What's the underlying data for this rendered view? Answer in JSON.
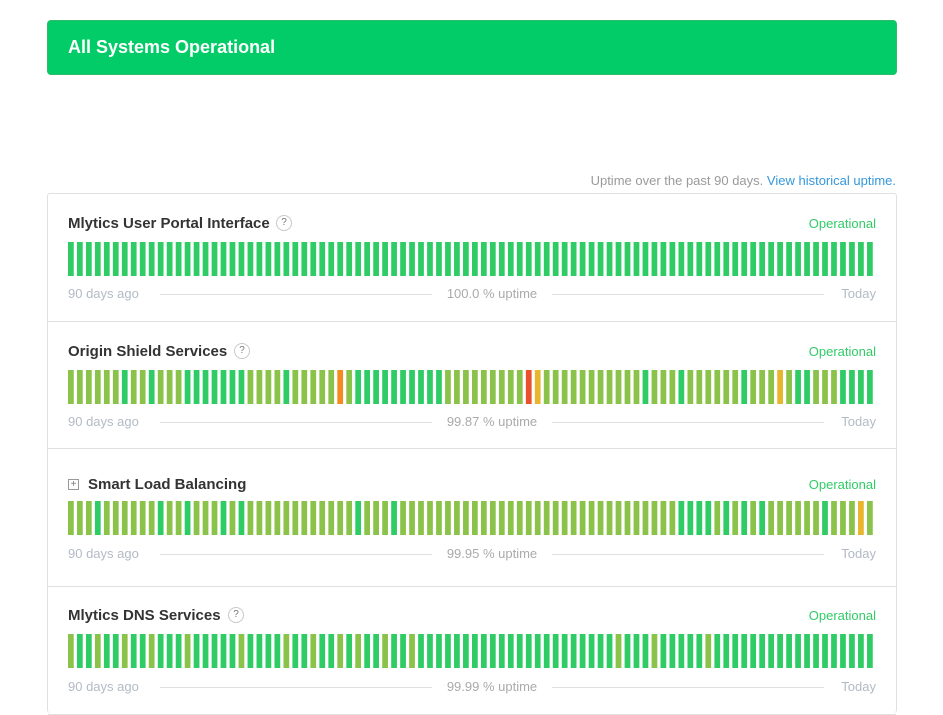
{
  "banner": {
    "text": "All Systems Operational"
  },
  "uptime_note": {
    "text": "Uptime over the past 90 days.",
    "link": "View historical uptime."
  },
  "colors": {
    "green": "#2fcc66",
    "dark_green": "#17c37b",
    "light_green": "#8bc34a",
    "yellow_green": "#b0cc3c",
    "orange": "#f58a1f",
    "red": "#e8512c",
    "gold": "#e8b62c"
  },
  "components": [
    {
      "name": "Mlytics User Portal Interface",
      "help": "?",
      "status": "Operational",
      "days_ago": "90 days ago",
      "uptime": "100.0 % uptime",
      "today": "Today",
      "day_status": "gggggggggggggggggggggggggggggggggggggggggggggggggggggggggggggggggggggggggggggggggggggggggg"
    },
    {
      "name": "Origin Shield Services",
      "help": "?",
      "status": "Operational",
      "days_ago": "90 days ago",
      "uptime": "99.87 % uptime",
      "today": "Today",
      "day_status": "llllllgllglllgggggggllllglllllolgggggggggglllllllllrylllllllllllglllgllllllglllylgglllggggg"
    },
    {
      "name": "Smart Load Balancing",
      "toggle": "+",
      "status": "Operational",
      "days_ago": "90 days ago",
      "uptime": "99.95 % uptime",
      "today": "Today",
      "day_status": "lllgllllllgllglllglgllllllllllllglllglllllllllllllllllllllllllllllllgggglglglgllllllglllyl"
    },
    {
      "name": "Mlytics DNS Services",
      "help": "?",
      "status": "Operational",
      "days_ago": "90 days ago",
      "uptime": "99.99 % uptime",
      "today": "Today",
      "day_status": "lgglgglgglggglggggglgggglgglgglglgglgglgggggggggggggggggggggglggglggggglgggggggggggggggggggg"
    }
  ]
}
